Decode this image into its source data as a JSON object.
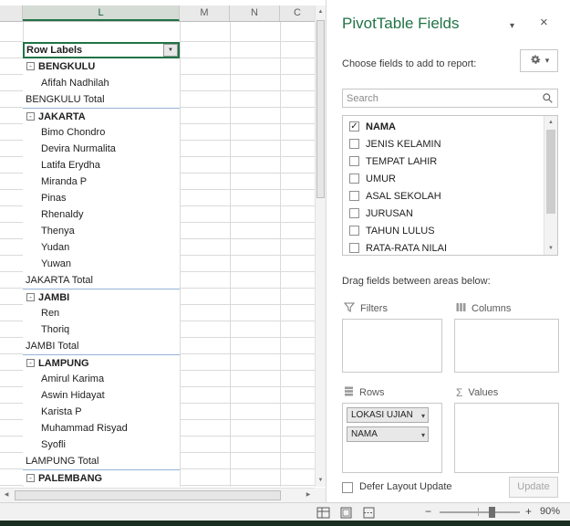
{
  "spreadsheet": {
    "col_headers": [
      "",
      "L",
      "M",
      "N",
      "C"
    ],
    "rows": [
      {
        "label": "Row Labels",
        "type": "header"
      },
      {
        "label": "BENGKULU",
        "type": "group"
      },
      {
        "label": "Afifah Nadhilah",
        "type": "item"
      },
      {
        "label": "BENGKULU Total",
        "type": "total"
      },
      {
        "label": "JAKARTA",
        "type": "group"
      },
      {
        "label": "Bimo Chondro",
        "type": "item"
      },
      {
        "label": "Devira Nurmalita",
        "type": "item"
      },
      {
        "label": "Latifa Erydha",
        "type": "item"
      },
      {
        "label": "Miranda P",
        "type": "item"
      },
      {
        "label": "Pinas",
        "type": "item"
      },
      {
        "label": "Rhenaldy",
        "type": "item"
      },
      {
        "label": "Thenya",
        "type": "item"
      },
      {
        "label": "Yudan",
        "type": "item"
      },
      {
        "label": "Yuwan",
        "type": "item"
      },
      {
        "label": "JAKARTA Total",
        "type": "total"
      },
      {
        "label": "JAMBI",
        "type": "group"
      },
      {
        "label": "Ren",
        "type": "item"
      },
      {
        "label": "Thoriq",
        "type": "item"
      },
      {
        "label": "JAMBI Total",
        "type": "total"
      },
      {
        "label": "LAMPUNG",
        "type": "group"
      },
      {
        "label": "Amirul Karima",
        "type": "item"
      },
      {
        "label": "Aswin Hidayat",
        "type": "item"
      },
      {
        "label": "Karista P",
        "type": "item"
      },
      {
        "label": "Muhammad Risyad",
        "type": "item"
      },
      {
        "label": "Syofli",
        "type": "item"
      },
      {
        "label": "LAMPUNG Total",
        "type": "total"
      },
      {
        "label": "PALEMBANG",
        "type": "group"
      }
    ]
  },
  "panel": {
    "title": "PivotTable Fields",
    "choose_label": "Choose fields to add to report:",
    "search_placeholder": "Search",
    "fields": [
      {
        "name": "NAMA",
        "checked": true
      },
      {
        "name": "JENIS KELAMIN",
        "checked": false
      },
      {
        "name": "TEMPAT LAHIR",
        "checked": false
      },
      {
        "name": "UMUR",
        "checked": false
      },
      {
        "name": "ASAL SEKOLAH",
        "checked": false
      },
      {
        "name": "JURUSAN",
        "checked": false
      },
      {
        "name": "TAHUN LULUS",
        "checked": false
      },
      {
        "name": "RATA-RATA NILAI",
        "checked": false
      }
    ],
    "drag_label": "Drag fields between areas below:",
    "areas": {
      "filters": {
        "label": "Filters",
        "items": []
      },
      "columns": {
        "label": "Columns",
        "items": []
      },
      "rows": {
        "label": "Rows",
        "items": [
          "LOKASI UJIAN",
          "NAMA"
        ]
      },
      "values": {
        "label": "Values",
        "items": []
      }
    },
    "defer_label": "Defer Layout Update",
    "update_label": "Update"
  },
  "statusbar": {
    "zoom_level": "90%"
  },
  "icons": {
    "check": "✓",
    "dropdown": "▾",
    "filter_arrow": "▼",
    "minus": "-",
    "close": "×",
    "caret": "▾",
    "sigma": "Σ",
    "up": "▲",
    "down": "▼",
    "left": "◀",
    "right": "▶",
    "zoom_minus": "−",
    "zoom_plus": "+"
  },
  "colors": {
    "accent_green": "#217346",
    "group_line_blue": "#95b3d7"
  }
}
